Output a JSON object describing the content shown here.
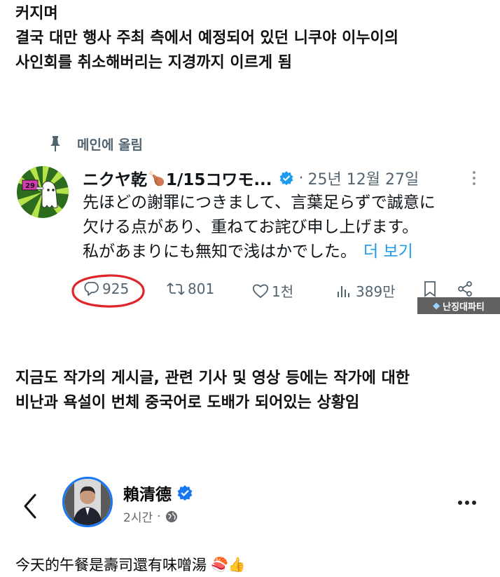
{
  "caption_top": {
    "lines": [
      "커지며",
      "결국 대만 행사 주최 측에서 예정되어 있던 니쿠야 이누이의",
      "사인회를 취소해버리는 지경까지 이르게 됨"
    ]
  },
  "x_post": {
    "pinned_label": "메인에 올림",
    "display_name": "ニクヤ乾",
    "name_emoji": "🍗",
    "name_tail": "1/15コワモ...",
    "date": "25년 12월 27일",
    "text_lines": [
      "先ほどの謝罪につきまして、言葉足らずで誠意に",
      "欠ける点があり、重ねてお詫び申し上げます。",
      "私があまりにも無知で浅はかでした。"
    ],
    "show_more": "더 보기",
    "actions": {
      "replies": "925",
      "reposts": "801",
      "likes": "1천",
      "views": "389만"
    },
    "avatar_sign": "29"
  },
  "watermark": {
    "text": "난징대파티"
  },
  "caption_middle": {
    "lines": [
      "지금도 작가의 게시글, 관련 기사 및 영상 등에는 작가에 대한",
      "비난과 욕설이 번체 중국어로 도배가 되어있는 상황임"
    ]
  },
  "fb_post": {
    "name": "賴清德",
    "time": "2시간",
    "separator": "·",
    "text": "今天的午餐是壽司還有味噌湯",
    "emojis": "🍣👍"
  },
  "colors": {
    "x_blue": "#1d9bf0",
    "fb_blue": "#1877f2",
    "annotation_red": "#e0242a",
    "muted": "#536471"
  }
}
